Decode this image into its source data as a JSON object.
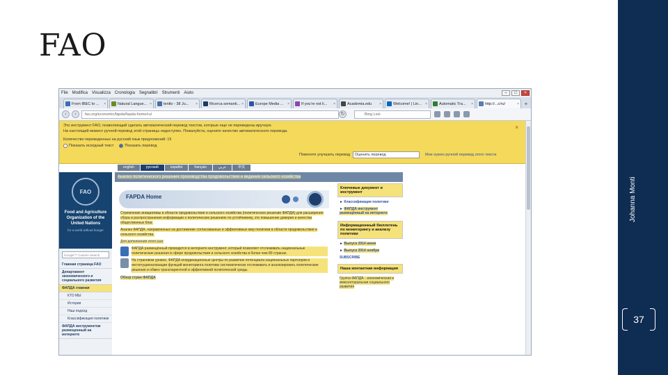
{
  "slide": {
    "title": "FAO",
    "author": "Johanna Monti",
    "page_number": "37",
    "sidebar_color": "#0f2d52"
  },
  "browser": {
    "menu": [
      "File",
      "Modifica",
      "Visualizza",
      "Cronologia",
      "Segnalibri",
      "Strumenti",
      "Aiuto"
    ],
    "tabs": [
      {
        "label": "From IBEC to ...",
        "icon_color": "#3a6fb5"
      },
      {
        "label": "Natural Langue...",
        "icon_color": "#6b8e23"
      },
      {
        "label": "tentlo - 38 Ju...",
        "icon_color": "#4a6fa5"
      },
      {
        "label": "Ricerca semanti...",
        "icon_color": "#1f3b63"
      },
      {
        "label": "Europe Media ...",
        "icon_color": "#2b55a8"
      },
      {
        "label": "If you're not li...",
        "icon_color": "#8e44ad"
      },
      {
        "label": "Academia.edu",
        "icon_color": "#444444"
      },
      {
        "label": "Welcome! | Lin...",
        "icon_color": "#0a66c2"
      },
      {
        "label": "Automatic Tra...",
        "icon_color": "#2e7d32"
      },
      {
        "label": "http://...c/ru/",
        "icon_color": "#5a7db0",
        "active": true
      }
    ],
    "url": "fao.org/economic/fapda/fapda-home/ru/",
    "search_placeholder": "Bing Lexi"
  },
  "translate_bar": {
    "line1": "Это инструмент FAO, позволяющий сделать автоматический перевод текстов, которые еще не переведены вручную.",
    "line2": "На настоящий момент ручной перевод этой страницы недоступен. Пожалуйста, оцените качество автоматического перевода.",
    "line3": "Количество переведенных на русский язык предложений: 15",
    "option_original": "Показать исходный текст",
    "option_translated": "Показать перевод",
    "help_label": "Помогите улучшить перевод",
    "select_value": "Оценить перевод",
    "link_manual": "Мне нужен ручной перевод этого текста",
    "close": "×"
  },
  "fao_site": {
    "languages": [
      "english",
      "русский",
      "español",
      "français",
      "عربي",
      "中文"
    ],
    "current_language": "русский",
    "org_name": "Food and Agriculture Organization of the United Nations",
    "motto": "for a world without hunger",
    "emblem_text": "FAO",
    "search_placeholder": "Google™ Custom Search",
    "nav": [
      {
        "label": "Главная страница FAO",
        "type": "it"
      },
      {
        "label": "Департамент экономического и социального развития",
        "type": "it"
      },
      {
        "label": "ФАПДА главная",
        "type": "it",
        "hl": true
      },
      {
        "label": "КТО МЫ",
        "type": "sub"
      },
      {
        "label": "История",
        "type": "sub"
      },
      {
        "label": "Наш подход",
        "type": "sub"
      },
      {
        "label": "Классификация политики",
        "type": "sub"
      },
      {
        "label": "ФАПДА инструментом размещенный на интернете",
        "type": "it"
      }
    ],
    "banner": "Анализ политического решения производства продовольствия и ведения сельского хозяйства",
    "home_title": "FAPDA Home",
    "para1": "Стремление инициативы в области продовольствия и сельского хозяйства (политическое решение ФАПДА) для расширения сбора и распространения информации о политических решениях по устойчивому, это повышение доверия и качества общественных благ.",
    "para2": "Анализ ФАПДА, направленных на достижение согласованных и эффективных мер политики в области продовольствия и сельского хозяйства.",
    "link_more": "Для дополнения этого шаг",
    "para3": "ФАПДА размещённый проводится в интернете инструмент, который позволяет отслеживать национальные политические решения в сфере продовольствия и сельского хозяйства в более чем 80 странах.",
    "para4": "На страновом уровне, ФАПДА координационные центры по развитию потенциала национальных партнеров и институционализации функций мониторинга политики систематически отслеживать и анализировать политические решения и обмен транспарентной и эффективной политической среды.",
    "link_about": "Обзор стран ФАПДА",
    "right": {
      "box1": "Ключевые документ и инструмент",
      "link1": "Классификация политики",
      "link2": "ФАПДА инструмент размещённый на интернете",
      "box2": "Информационный бюллетень по мониторингу и анализу политики",
      "link3": "Выпуск 2014 июня",
      "link4": "Выпуск 2014 ноябри",
      "subscribe": "SUBSCRIBE",
      "box3": "Наша контактная информация",
      "contact": "Группа ФАПДА - экономическая и межсекторальная социального развития"
    }
  }
}
